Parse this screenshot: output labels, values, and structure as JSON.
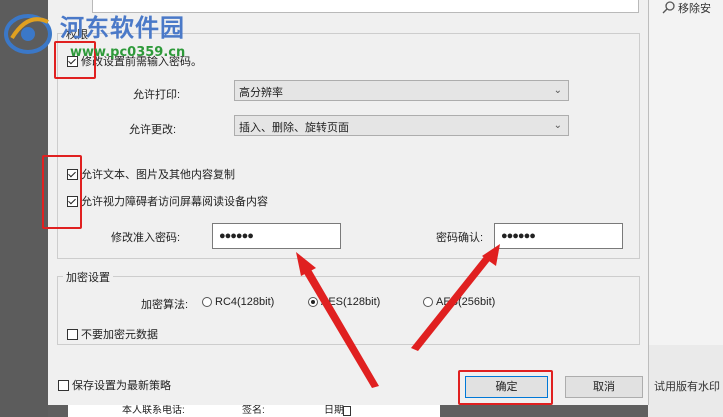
{
  "watermark": {
    "title": "河东软件园",
    "url": "www.pc0359.cn"
  },
  "right_panel": {
    "remove_text": "移除安",
    "trial_text": "试用版有水印"
  },
  "background_doc": {
    "contact": "本人联系电话:",
    "sign": "签名:",
    "date": "日期:"
  },
  "permissions": {
    "title": "权限",
    "require_password_label": "修改设置前需输入密码。",
    "allow_print_label": "允许打印:",
    "allow_print_value": "高分辨率",
    "allow_change_label": "允许更改:",
    "allow_change_value": "插入、删除、旋转页面",
    "allow_copy_label": "允许文本、图片及其他内容复制",
    "allow_accessibility_label": "允许视力障碍者访问屏幕阅读设备内容",
    "password_label": "修改准入密码:",
    "password_value": "●●●●●●",
    "confirm_label": "密码确认:",
    "confirm_value": "●●●●●●"
  },
  "encryption": {
    "title": "加密设置",
    "algorithm_label": "加密算法:",
    "options": [
      "RC4(128bit)",
      "AES(128bit)",
      "AES(256bit)"
    ],
    "selected_index": 1,
    "no_metadata_label": "不要加密元数据"
  },
  "footer": {
    "save_default_label": "保存设置为最新策略",
    "ok_label": "确定",
    "cancel_label": "取消"
  }
}
